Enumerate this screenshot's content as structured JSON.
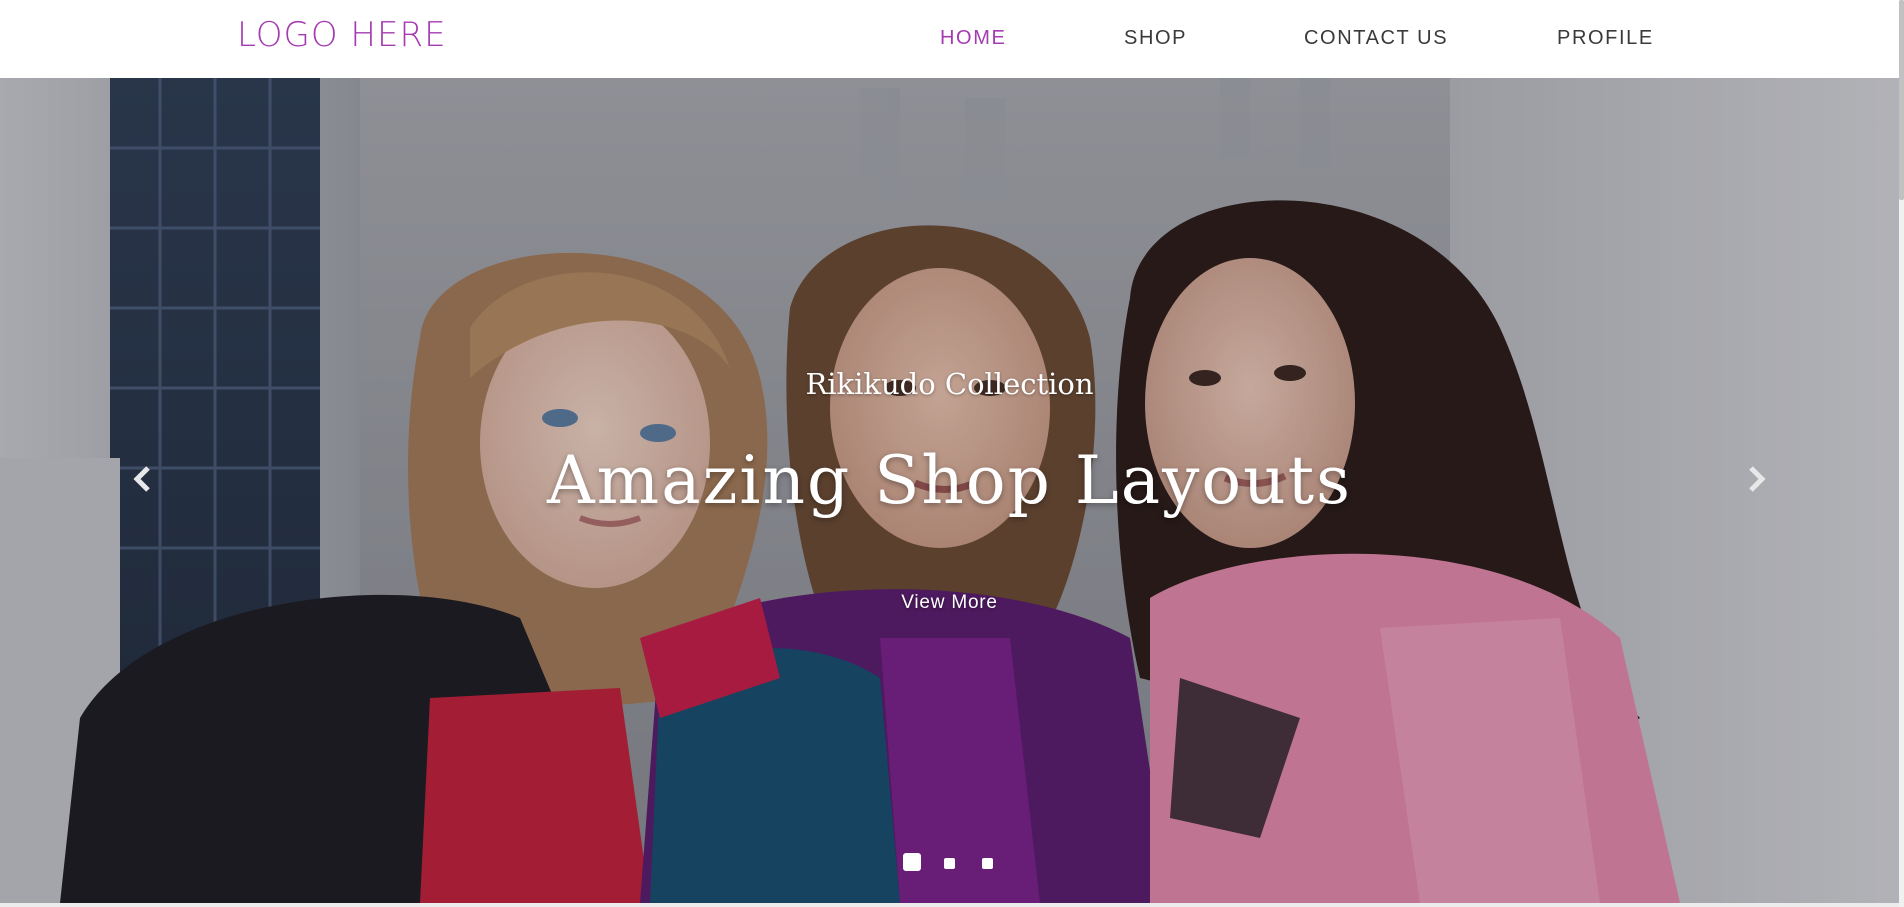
{
  "header": {
    "logo": "LOGO HERE",
    "nav": [
      {
        "label": "HOME",
        "active": true
      },
      {
        "label": "SHOP",
        "active": false
      },
      {
        "label": "CONTACT US",
        "active": false
      },
      {
        "label": "PROFILE",
        "active": false
      }
    ]
  },
  "hero": {
    "subtitle": "Rikikudo Collection",
    "title": "Amazing Shop Layouts",
    "button_label": "View More",
    "prev_icon": "chevron-left-icon",
    "next_icon": "chevron-right-icon",
    "slide_count": 3,
    "active_slide": 1
  },
  "colors": {
    "accent": "#a43bb0",
    "nav_text": "#3a3a3a",
    "hero_text": "#ffffff"
  }
}
